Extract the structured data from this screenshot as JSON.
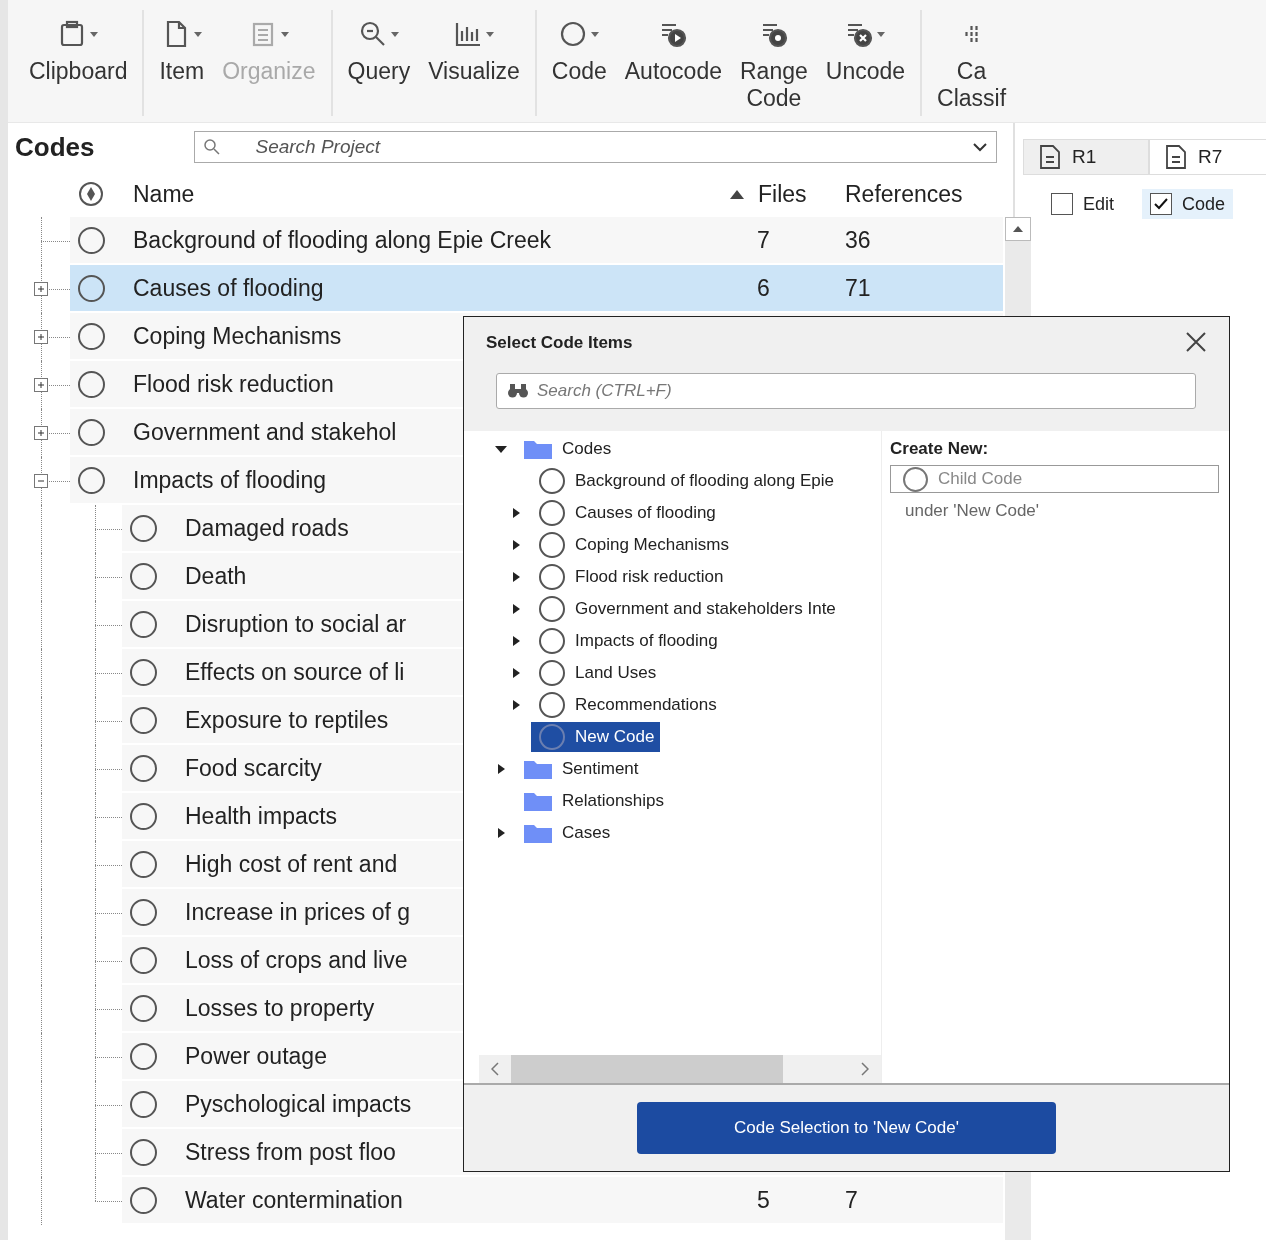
{
  "toolbar": {
    "groups": [
      {
        "buttons": [
          {
            "lines": [
              "Clipboard"
            ],
            "dropdown": true,
            "disabled": false
          }
        ]
      },
      {
        "buttons": [
          {
            "lines": [
              "Item"
            ],
            "dropdown": true,
            "disabled": false
          },
          {
            "lines": [
              "Organize"
            ],
            "dropdown": true,
            "disabled": true
          }
        ]
      },
      {
        "buttons": [
          {
            "lines": [
              "Query"
            ],
            "dropdown": true,
            "disabled": false
          },
          {
            "lines": [
              "Visualize"
            ],
            "dropdown": true,
            "disabled": false
          }
        ]
      },
      {
        "buttons": [
          {
            "lines": [
              "Code"
            ],
            "dropdown": true,
            "disabled": false
          },
          {
            "lines": [
              "Autocode"
            ],
            "dropdown": false,
            "disabled": false
          },
          {
            "lines": [
              "Range",
              "Code"
            ],
            "dropdown": false,
            "disabled": false
          },
          {
            "lines": [
              "Uncode"
            ],
            "dropdown": true,
            "disabled": false
          }
        ]
      },
      {
        "buttons": [
          {
            "lines": [
              "Ca",
              "Classif"
            ],
            "dropdown": false,
            "disabled": false
          }
        ]
      }
    ]
  },
  "codes_panel": {
    "title": "Codes",
    "search": {
      "placeholder": "Search Project"
    },
    "columns": {
      "name": "Name",
      "files": "Files",
      "references": "References"
    },
    "rows": [
      {
        "name": "Background of flooding along Epie Creek",
        "files": "7",
        "references": "36",
        "selected": false
      },
      {
        "name": "Causes of flooding",
        "files": "6",
        "references": "71",
        "selected": true,
        "expanded": false
      },
      {
        "name": "Coping Mechanisms",
        "selected": false,
        "expanded": false
      },
      {
        "name": "Flood risk reduction",
        "selected": false,
        "expanded": false
      },
      {
        "name": "Government and stakehol",
        "selected": false,
        "expanded": false
      },
      {
        "name": "Impacts of flooding",
        "selected": false,
        "expanded": true,
        "children": [
          {
            "name": "Damaged roads",
            "selected": false
          },
          {
            "name": "Death",
            "selected": false
          },
          {
            "name": "Disruption to social ar",
            "selected": false
          },
          {
            "name": "Effects on source of li",
            "selected": false
          },
          {
            "name": "Exposure to reptiles",
            "selected": false
          },
          {
            "name": "Food scarcity",
            "selected": false
          },
          {
            "name": "Health impacts",
            "selected": false
          },
          {
            "name": "High cost of rent and",
            "selected": false
          },
          {
            "name": "Increase in prices of g",
            "selected": false
          },
          {
            "name": "Loss of crops and live",
            "selected": false
          },
          {
            "name": "Losses to property",
            "selected": false
          },
          {
            "name": "Power outage",
            "selected": false
          },
          {
            "name": "Pyschological impacts",
            "selected": false
          },
          {
            "name": "Stress from post floo",
            "selected": false
          },
          {
            "name": "Water contermination",
            "files": "5",
            "references": "7",
            "selected": false
          }
        ]
      }
    ]
  },
  "right_panel": {
    "tabs": [
      {
        "label": "R1",
        "selected": false
      },
      {
        "label": "R7",
        "selected": true
      }
    ],
    "options": [
      {
        "label": "Edit",
        "checked": false
      },
      {
        "label": "Code",
        "checked": true
      }
    ]
  },
  "dialog": {
    "title": "Select Code Items",
    "search": {
      "placeholder": "Search (CTRL+F)"
    },
    "tree": [
      {
        "kind": "folder",
        "label": "Codes",
        "expanded": true,
        "children": [
          {
            "kind": "code",
            "label": "Background of flooding along Epie",
            "selected": false
          },
          {
            "kind": "code",
            "label": "Causes of flooding",
            "expanded": false,
            "selected": false
          },
          {
            "kind": "code",
            "label": "Coping Mechanisms",
            "expanded": false,
            "selected": false
          },
          {
            "kind": "code",
            "label": "Flood risk reduction",
            "expanded": false,
            "selected": false
          },
          {
            "kind": "code",
            "label": "Government and stakeholders Inte",
            "expanded": false,
            "selected": false
          },
          {
            "kind": "code",
            "label": "Impacts of flooding",
            "expanded": false,
            "selected": false
          },
          {
            "kind": "code",
            "label": "Land Uses",
            "expanded": false,
            "selected": false
          },
          {
            "kind": "code",
            "label": "Recommendations",
            "expanded": false,
            "selected": false
          },
          {
            "kind": "code",
            "label": "New Code",
            "selected": true
          }
        ]
      },
      {
        "kind": "folder",
        "label": "Sentiment",
        "expanded": false
      },
      {
        "kind": "folder",
        "label": "Relationships"
      },
      {
        "kind": "folder",
        "label": "Cases",
        "expanded": false
      }
    ],
    "create_new": {
      "label": "Create New:",
      "field": {
        "placeholder": "Child Code"
      },
      "hint": "under 'New Code'"
    },
    "button": "Code Selection to 'New Code'"
  }
}
